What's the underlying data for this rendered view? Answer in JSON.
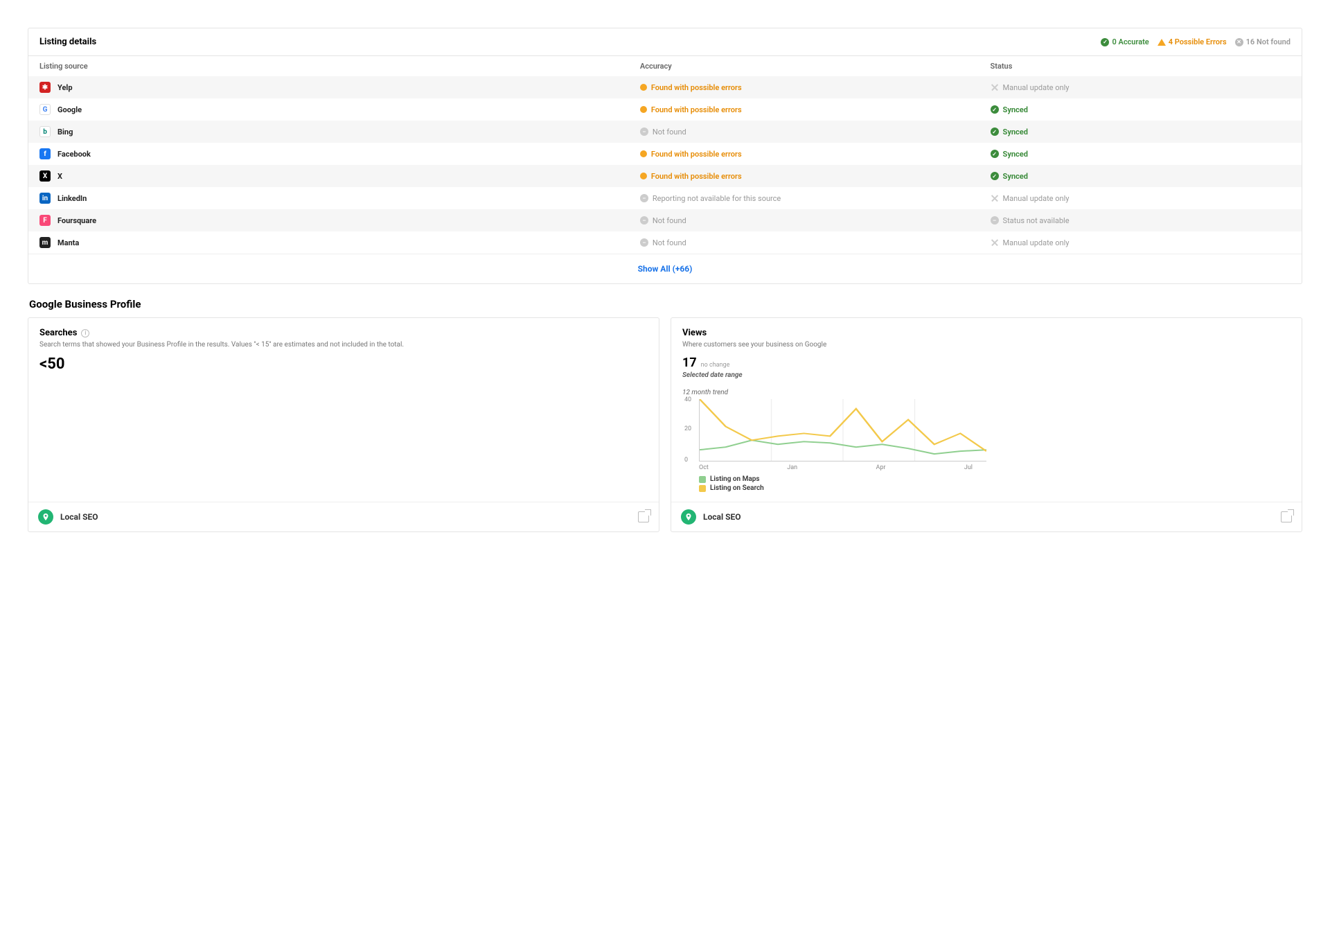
{
  "listing_details": {
    "title": "Listing details",
    "legend": {
      "accurate": "0 Accurate",
      "possible_errors": "4 Possible Errors",
      "not_found": "16 Not found"
    },
    "columns": {
      "source": "Listing source",
      "accuracy": "Accuracy",
      "status": "Status"
    },
    "rows": [
      {
        "name": "Yelp",
        "icon_bg": "#d32323",
        "icon_txt": "✱",
        "accuracy": "Found with possible errors",
        "accuracy_type": "warn",
        "status": "Manual update only",
        "status_type": "manual"
      },
      {
        "name": "Google",
        "icon_bg": "#ffffff",
        "icon_txt": "G",
        "icon_color": "#4285F4",
        "icon_border": "1px solid #ddd",
        "accuracy": "Found with possible errors",
        "accuracy_type": "warn",
        "status": "Synced",
        "status_type": "synced"
      },
      {
        "name": "Bing",
        "icon_bg": "#ffffff",
        "icon_txt": "b",
        "icon_color": "#008373",
        "icon_border": "1px solid #ddd",
        "accuracy": "Not found",
        "accuracy_type": "gray",
        "status": "Synced",
        "status_type": "synced"
      },
      {
        "name": "Facebook",
        "icon_bg": "#1877f2",
        "icon_txt": "f",
        "accuracy": "Found with possible errors",
        "accuracy_type": "warn",
        "status": "Synced",
        "status_type": "synced"
      },
      {
        "name": "X",
        "icon_bg": "#000000",
        "icon_txt": "X",
        "accuracy": "Found with possible errors",
        "accuracy_type": "warn",
        "status": "Synced",
        "status_type": "synced"
      },
      {
        "name": "LinkedIn",
        "icon_bg": "#0a66c2",
        "icon_txt": "in",
        "accuracy": "Reporting not available for this source",
        "accuracy_type": "gray",
        "status": "Manual update only",
        "status_type": "manual"
      },
      {
        "name": "Foursquare",
        "icon_bg": "#f94877",
        "icon_txt": "F",
        "accuracy": "Not found",
        "accuracy_type": "gray",
        "status": "Status not available",
        "status_type": "na"
      },
      {
        "name": "Manta",
        "icon_bg": "#222222",
        "icon_txt": "m",
        "accuracy": "Not found",
        "accuracy_type": "gray",
        "status": "Manual update only",
        "status_type": "manual"
      }
    ],
    "show_all": "Show All (+66)"
  },
  "gbp": {
    "section_title": "Google Business Profile",
    "searches": {
      "title": "Searches",
      "subtitle": "Search terms that showed your Business Profile in the results. Values \"< 15\" are estimates and not included in the total.",
      "value": "<50",
      "footer": "Local SEO"
    },
    "views": {
      "title": "Views",
      "subtitle": "Where customers see your business on Google",
      "value": "17",
      "nochange": "no change",
      "selected_range": "Selected date range",
      "trend_label": "12 month trend",
      "y_ticks": [
        "40",
        "20",
        "0"
      ],
      "x_ticks": [
        "Oct",
        "Jan",
        "Apr",
        "Jul"
      ],
      "legend_maps": "Listing on Maps",
      "legend_search": "Listing on Search",
      "footer": "Local SEO"
    }
  },
  "chart_data": {
    "type": "line",
    "title": "12 month trend",
    "ylabel": "",
    "xlabel": "",
    "ylim": [
      0,
      45
    ],
    "x": [
      "Oct",
      "Nov",
      "Dec",
      "Jan",
      "Feb",
      "Mar",
      "Apr",
      "May",
      "Jun",
      "Jul",
      "Aug",
      "Sep"
    ],
    "series": [
      {
        "name": "Listing on Maps",
        "color": "#8fcf8f",
        "values": [
          8,
          10,
          15,
          12,
          14,
          13,
          10,
          12,
          9,
          5,
          7,
          8
        ]
      },
      {
        "name": "Listing on Search",
        "color": "#f3c94b",
        "values": [
          45,
          25,
          15,
          18,
          20,
          18,
          38,
          14,
          30,
          12,
          20,
          7
        ]
      }
    ]
  }
}
